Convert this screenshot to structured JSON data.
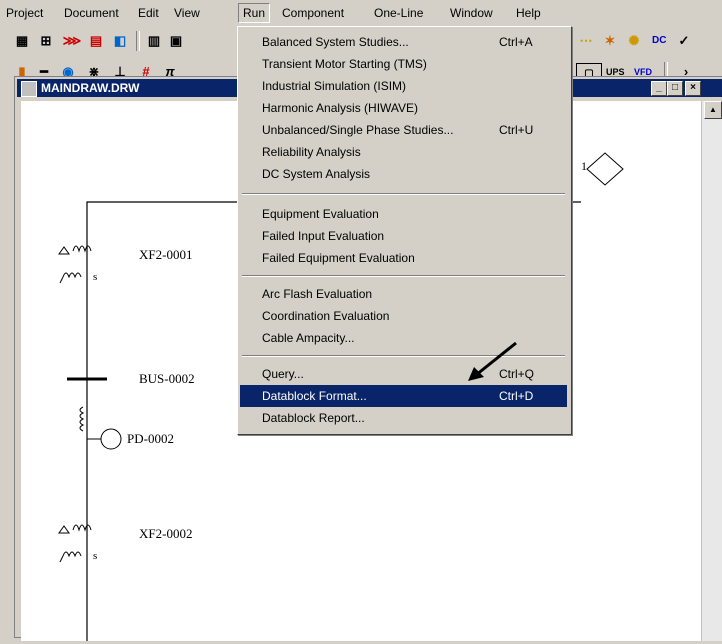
{
  "menubar": {
    "items": [
      "Project",
      "Document",
      "Edit",
      "View",
      "Run",
      "Component",
      "One-Line",
      "Window",
      "Help"
    ]
  },
  "toolbar2": {
    "ups_label": "UPS",
    "vfd_label": "VFD"
  },
  "toolbar1": {
    "dc_label": "DC"
  },
  "child_window": {
    "title": "MAINDRAW.DRW",
    "min_label": "_",
    "max_label": "□",
    "close_label": "×"
  },
  "drawing": {
    "labels": {
      "xf1": "XF2-0001",
      "bus": "BUS-0002",
      "pd": "PD-0002",
      "xf2": "XF2-0002",
      "s1": "s",
      "s2": "s",
      "callout": "1"
    }
  },
  "run_menu": {
    "groups": [
      [
        {
          "label": "Balanced System Studies...",
          "shortcut": "Ctrl+A"
        },
        {
          "label": "Transient Motor Starting (TMS)",
          "shortcut": ""
        },
        {
          "label": "Industrial Simulation (ISIM)",
          "shortcut": ""
        },
        {
          "label": "Harmonic Analysis (HIWAVE)",
          "shortcut": ""
        },
        {
          "label": "Unbalanced/Single Phase Studies...",
          "shortcut": "Ctrl+U"
        },
        {
          "label": "Reliability Analysis",
          "shortcut": ""
        },
        {
          "label": "DC System Analysis",
          "shortcut": ""
        }
      ],
      [
        {
          "label": "Equipment Evaluation",
          "shortcut": ""
        },
        {
          "label": "Failed Input Evaluation",
          "shortcut": ""
        },
        {
          "label": "Failed Equipment Evaluation",
          "shortcut": ""
        }
      ],
      [
        {
          "label": "Arc Flash Evaluation",
          "shortcut": ""
        },
        {
          "label": "Coordination Evaluation",
          "shortcut": ""
        },
        {
          "label": "Cable Ampacity...",
          "shortcut": ""
        }
      ],
      [
        {
          "label": "Query...",
          "shortcut": "Ctrl+Q"
        },
        {
          "label": "Datablock Format...",
          "shortcut": "Ctrl+D",
          "highlighted": true
        },
        {
          "label": "Datablock Report...",
          "shortcut": ""
        }
      ]
    ]
  },
  "colors": {
    "highlight": "#0a246a",
    "face": "#d4d0c8",
    "titlebar": "#0a246a"
  }
}
